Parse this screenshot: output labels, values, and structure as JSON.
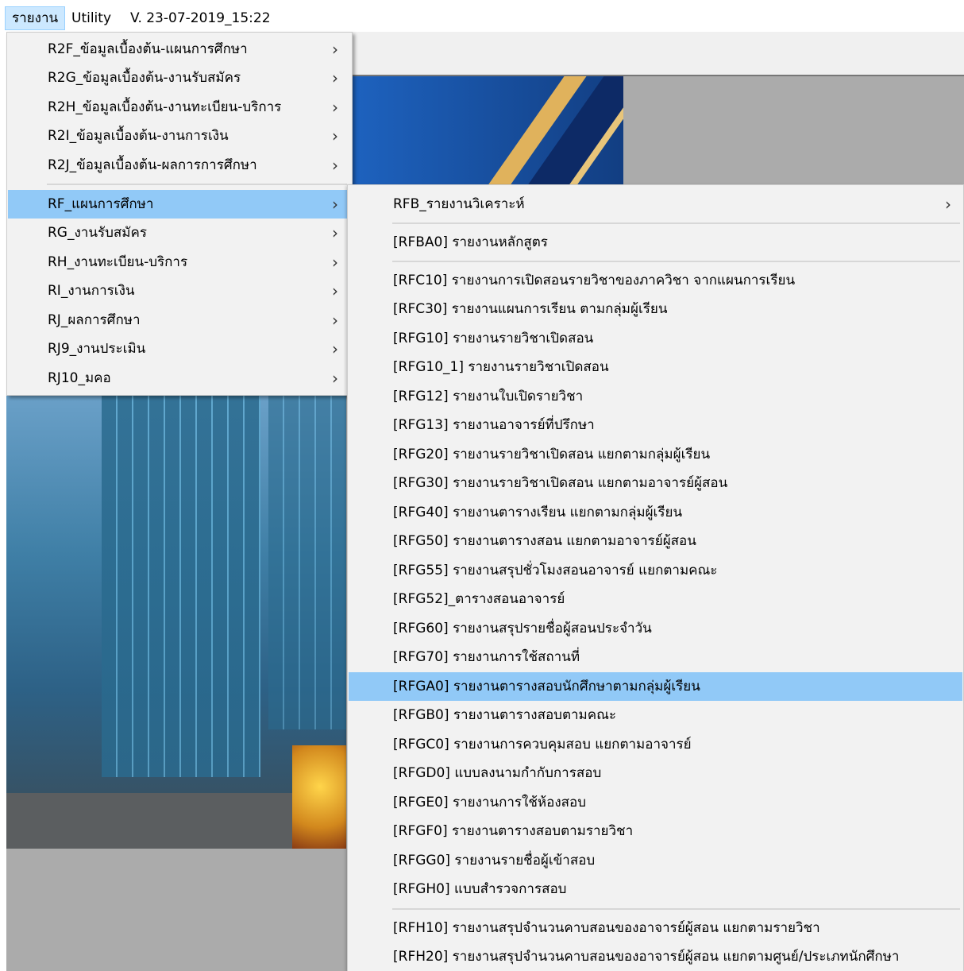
{
  "menubar": {
    "items": [
      {
        "label": "รายงาน"
      },
      {
        "label": "Utility"
      },
      {
        "label": "V. 23-07-2019_15:22"
      }
    ]
  },
  "menu1": {
    "items": [
      {
        "label": "R2F_ข้อมูลเบื้องต้น-แผนการศึกษา"
      },
      {
        "label": "R2G_ข้อมูลเบื้องต้น-งานรับสมัคร"
      },
      {
        "label": "R2H_ข้อมูลเบื้องต้น-งานทะเบียน-บริการ"
      },
      {
        "label": "R2I_ข้อมูลเบื้องต้น-งานการเงิน"
      },
      {
        "label": "R2J_ข้อมูลเบื้องต้น-ผลการการศึกษา"
      },
      {
        "label": "RF_แผนการศึกษา"
      },
      {
        "label": "RG_งานรับสมัคร"
      },
      {
        "label": "RH_งานทะเบียน-บริการ"
      },
      {
        "label": "RI_งานการเงิน"
      },
      {
        "label": "RJ_ผลการศึกษา"
      },
      {
        "label": "RJ9_งานประเมิน"
      },
      {
        "label": "RJ10_มคอ"
      }
    ],
    "arrow": "›"
  },
  "menu2": {
    "items": [
      {
        "label": "RFB_รายงานวิเคราะห์"
      },
      {
        "label": "[RFBA0] รายงานหลักสูตร"
      },
      {
        "label": "[RFC10] รายงานการเปิดสอนรายวิชาของภาควิชา จากแผนการเรียน"
      },
      {
        "label": "[RFC30] รายงานแผนการเรียน ตามกลุ่มผู้เรียน"
      },
      {
        "label": "[RFG10] รายงานรายวิชาเปิดสอน"
      },
      {
        "label": "[RFG10_1] รายงานรายวิชาเปิดสอน"
      },
      {
        "label": "[RFG12] รายงานใบเปิดรายวิชา"
      },
      {
        "label": "[RFG13] รายงานอาจารย์ที่ปรึกษา"
      },
      {
        "label": "[RFG20] รายงานรายวิชาเปิดสอน แยกตามกลุ่มผู้เรียน"
      },
      {
        "label": "[RFG30] รายงานรายวิชาเปิดสอน แยกตามอาจารย์ผู้สอน"
      },
      {
        "label": "[RFG40] รายงานตารางเรียน แยกตามกลุ่มผู้เรียน"
      },
      {
        "label": "[RFG50] รายงานตารางสอน แยกตามอาจารย์ผู้สอน"
      },
      {
        "label": "[RFG55] รายงานสรุปชั่วโมงสอนอาจารย์ แยกตามคณะ"
      },
      {
        "label": "[RFG52]_ตารางสอนอาจารย์"
      },
      {
        "label": "[RFG60] รายงานสรุปรายชื่อผู้สอนประจำวัน"
      },
      {
        "label": "[RFG70] รายงานการใช้สถานที่"
      },
      {
        "label": "[RFGA0] รายงานตารางสอบนักศึกษาตามกลุ่มผู้เรียน"
      },
      {
        "label": "[RFGB0] รายงานตารางสอบตามคณะ"
      },
      {
        "label": "[RFGC0] รายงานการควบคุมสอบ แยกตามอาจารย์"
      },
      {
        "label": "[RFGD0] แบบลงนามกำกับการสอบ"
      },
      {
        "label": "[RFGE0] รายงานการใช้ห้องสอบ"
      },
      {
        "label": "[RFGF0] รายงานตารางสอบตามรายวิชา"
      },
      {
        "label": "[RFGG0] รายงานรายชื่อผู้เข้าสอบ"
      },
      {
        "label": "[RFGH0] แบบสำรวจการสอบ"
      },
      {
        "label": "[RFH10] รายงานสรุปจำนวนคาบสอนของอาจารย์ผู้สอน แยกตามรายวิชา"
      },
      {
        "label": "[RFH20] รายงานสรุปจำนวนคาบสอนของอาจารย์ผู้สอน แยกตามศูนย์/ประเภทนักศึกษา"
      }
    ],
    "arrow": "›"
  }
}
